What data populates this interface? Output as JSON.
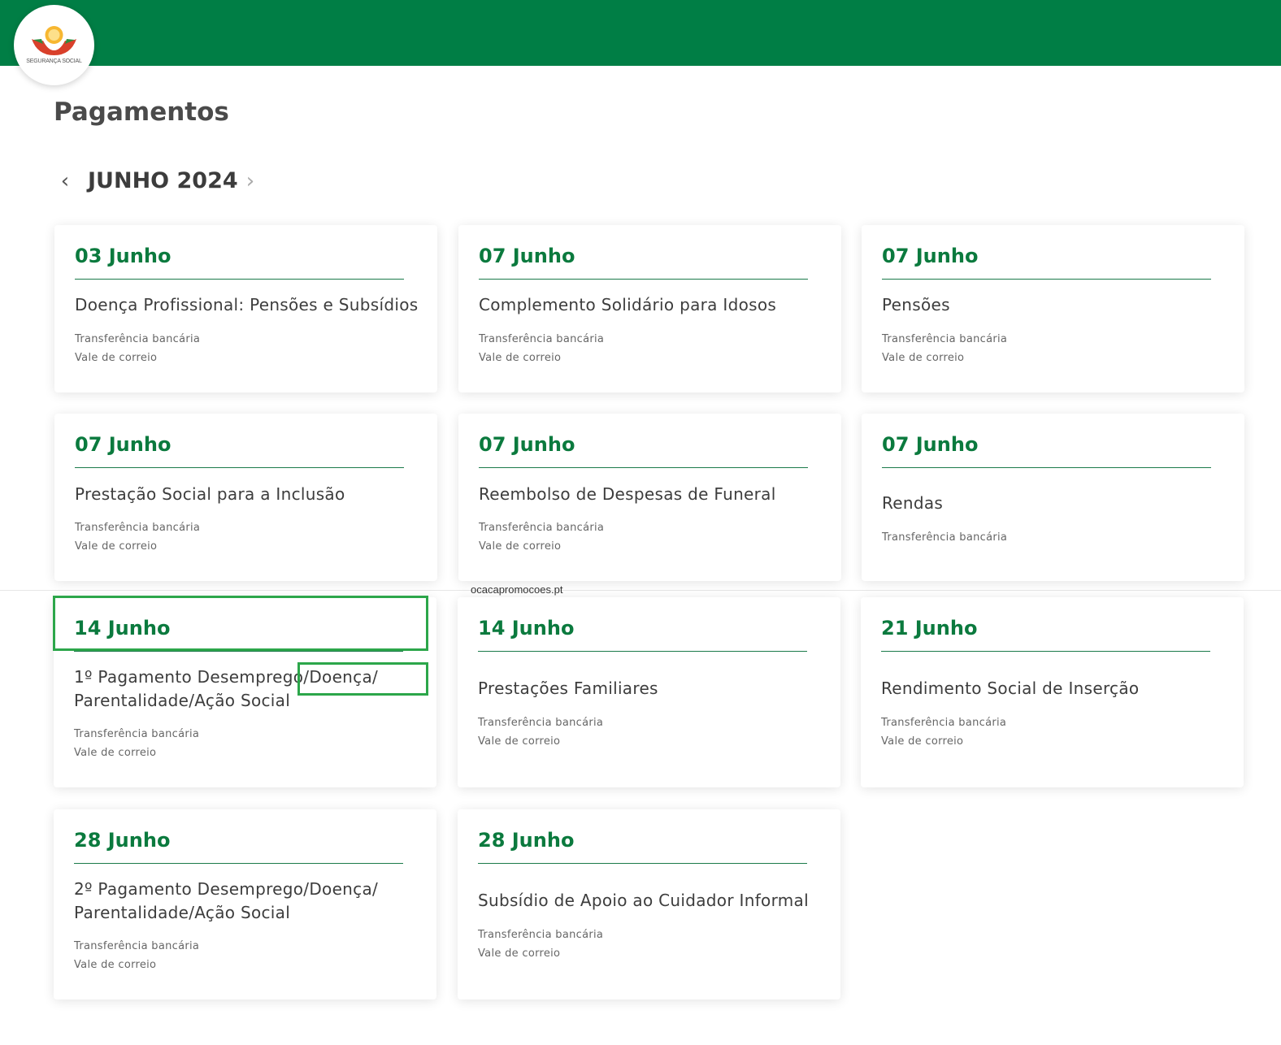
{
  "header": {
    "logo_text": "SEGURANÇA SOCIAL",
    "brand_color": "#007e45"
  },
  "page": {
    "title": "Pagamentos",
    "month": "JUNHO 2024",
    "prev_icon": "chevron-left-icon",
    "next_icon": "chevron-right-icon"
  },
  "watermark": "ocacapromocoes.pt",
  "cards": [
    {
      "date": "03 Junho",
      "title": "Doença Profissional: Pensões e Subsídios",
      "methods": [
        "Transferência bancária",
        "Vale de correio"
      ]
    },
    {
      "date": "07 Junho",
      "title": "Complemento Solidário para Idosos",
      "methods": [
        "Transferência bancária",
        "Vale de correio"
      ]
    },
    {
      "date": "07 Junho",
      "title": "Pensões",
      "methods": [
        "Transferência bancária",
        "Vale de correio"
      ]
    },
    {
      "date": "07 Junho",
      "title": "Prestação Social para a Inclusão",
      "methods": [
        "Transferência bancária",
        "Vale de correio"
      ]
    },
    {
      "date": "07 Junho",
      "title": "Reembolso de Despesas de Funeral",
      "methods": [
        "Transferência bancária",
        "Vale de correio"
      ]
    },
    {
      "date": "07 Junho",
      "title": "Rendas",
      "methods": [
        "Transferência bancária"
      ]
    },
    {
      "date": "14 Junho",
      "title": "1º Pagamento Desemprego/Doença/ Parentalidade/Ação Social",
      "methods": [
        "Transferência bancária",
        "Vale de correio"
      ]
    },
    {
      "date": "14 Junho",
      "title": "Prestações Familiares",
      "methods": [
        "Transferência bancária",
        "Vale de correio"
      ]
    },
    {
      "date": "21 Junho",
      "title": "Rendimento Social de Inserção",
      "methods": [
        "Transferência bancária",
        "Vale de correio"
      ]
    },
    {
      "date": "28 Junho",
      "title": "2º Pagamento Desemprego/Doença/ Parentalidade/Ação Social",
      "methods": [
        "Transferência bancária",
        "Vale de correio"
      ]
    },
    {
      "date": "28 Junho",
      "title": "Subsídio de Apoio ao Cuidador Informal",
      "methods": [
        "Transferência bancária",
        "Vale de correio"
      ]
    }
  ],
  "highlight_color": "#2ca64a"
}
